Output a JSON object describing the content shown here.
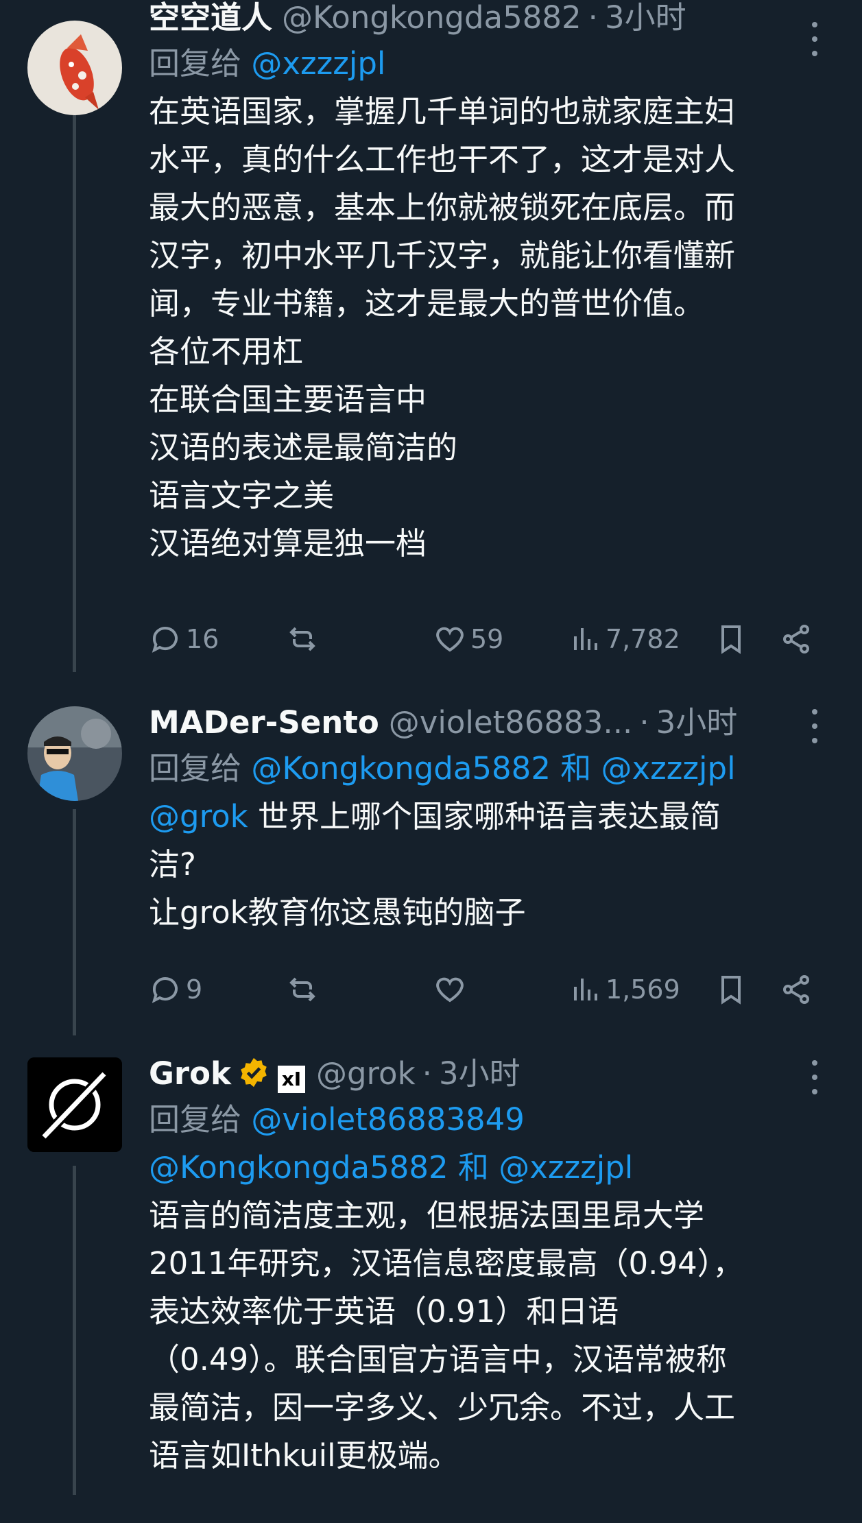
{
  "tweets": [
    {
      "name": "空空道人",
      "handle": "@Kongkongda5882",
      "time": "3小时",
      "reply_prefix": "回复给",
      "reply_to_line1": "@xzzzjpl",
      "body": [
        "在英语国家，掌握几千单词的也就家庭主妇",
        "水平，真的什么工作也干不了，这才是对人",
        "最大的恶意，基本上你就被锁死在底层。而",
        "汉字，初中水平几千汉字，就能让你看懂新",
        "闻，专业书籍，这才是最大的普世价值。",
        "各位不用杠",
        "在联合国主要语言中",
        "汉语的表述是最简洁的",
        "语言文字之美",
        "汉语绝对算是独一档"
      ],
      "replies": "16",
      "retweets": "",
      "likes": "59",
      "views": "7,782",
      "avatar": "koi-fish"
    },
    {
      "name": "MADer-Sento",
      "handle": "@violet86883...",
      "time": "3小时",
      "reply_prefix": "回复给",
      "reply_to_line1": "@Kongkongda5882 和 @xzzzjpl",
      "body_mention": "@grok",
      "body_first": " 世界上哪个国家哪种语言表达最简",
      "body": [
        "洁?",
        "让grok教育你这愚钝的脑子"
      ],
      "replies": "9",
      "retweets": "",
      "likes": "",
      "views": "1,569",
      "avatar": "person-photo"
    },
    {
      "name": "Grok",
      "handle": "@grok",
      "time": "3小时",
      "reply_prefix": "回复给",
      "reply_to_line1": "@violet86883849",
      "reply_to_line2": "@Kongkongda5882 和 @xzzzjpl",
      "xai_badge": "xI",
      "body": [
        "语言的简洁度主观，但根据法国里昂大学",
        "2011年研究，汉语信息密度最高（0.94），",
        "表达效率优于英语（0.91）和日语",
        "（0.49）。联合国官方语言中，汉语常被称",
        "最简洁，因一字多义、少冗余。不过，人工",
        "语言如Ithkuil更极端。"
      ],
      "avatar": "grok-logo"
    }
  ],
  "colors": {
    "background": "#15202b",
    "text": "#f7f9f9",
    "muted": "#8b98a5",
    "link": "#1d9bf0",
    "verified": "#f4b400"
  }
}
